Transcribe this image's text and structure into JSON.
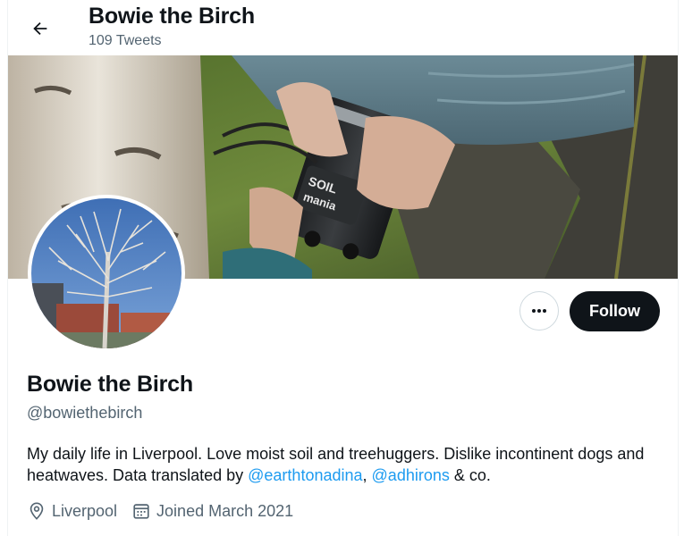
{
  "header": {
    "title": "Bowie the Birch",
    "tweet_count": "109 Tweets"
  },
  "profile": {
    "name": "Bowie the Birch",
    "handle": "@bowiethebirch",
    "bio_part1": "My daily life in Liverpool. Love moist soil and treehuggers. Dislike incontinent dogs and heatwaves. Data translated by ",
    "mention1": "@earthtonadina",
    "bio_sep": ", ",
    "mention2": "@adhirons",
    "bio_end": " & co.",
    "location": "Liverpool",
    "joined": "Joined March 2021"
  },
  "actions": {
    "follow_label": "Follow",
    "more_label": "···"
  },
  "banner": {
    "device_text_1": "SOIL",
    "device_text_2": "mania"
  },
  "colors": {
    "link": "#1d9bf0",
    "secondary_text": "#536471",
    "follow_bg": "#0f1419"
  },
  "icons": {
    "back": "arrow-left-icon",
    "more": "more-horizontal-icon",
    "location": "location-pin-icon",
    "calendar": "calendar-icon"
  }
}
